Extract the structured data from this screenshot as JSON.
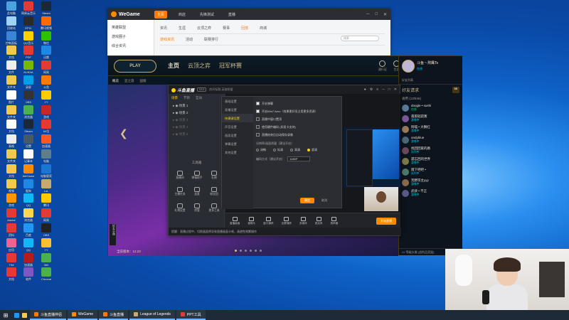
{
  "desktop": {
    "icons": [
      {
        "label": "此电脑",
        "color": "#4aa3df"
      },
      {
        "label": "网易云音乐",
        "color": "#e53935"
      },
      {
        "label": "Steam",
        "color": "#1b2838"
      },
      {
        "label": "回收站",
        "color": "#9fd3f5"
      },
      {
        "label": "EPIC",
        "color": "#2a2a2a"
      },
      {
        "label": "腾讯视频",
        "color": "#ff6a00"
      },
      {
        "label": "控制面板",
        "color": "#3a86d6"
      },
      {
        "label": "QQ音乐",
        "color": "#ffd000"
      },
      {
        "label": "微信",
        "color": "#2dc100"
      },
      {
        "label": "文档",
        "color": "#f2c94c"
      },
      {
        "label": "PDF",
        "color": "#e53935"
      },
      {
        "label": "迅雷",
        "color": "#1e88e5"
      },
      {
        "label": "文件",
        "color": "#eeeeee"
      },
      {
        "label": "NVIDIA",
        "color": "#76b900"
      },
      {
        "label": "网易",
        "color": "#e53935"
      },
      {
        "label": "文件夹",
        "color": "#f2c94c"
      },
      {
        "label": "录屏",
        "color": "#00a0e9"
      },
      {
        "label": "斗鱼",
        "color": "#ff7a00"
      },
      {
        "label": "图片",
        "color": "#ffffff"
      },
      {
        "label": "OBS",
        "color": "#333333"
      },
      {
        "label": "YY",
        "color": "#ffcc00"
      },
      {
        "label": "文件夹",
        "color": "#f2c94c"
      },
      {
        "label": "浏览器",
        "color": "#4caf50"
      },
      {
        "label": "游戏",
        "color": "#c62828"
      },
      {
        "label": "文档",
        "color": "#ffffff"
      },
      {
        "label": "Steam",
        "color": "#1b2838"
      },
      {
        "label": "64位",
        "color": "#e53935"
      },
      {
        "label": "表格",
        "color": "#eeeeee"
      },
      {
        "label": "设置",
        "color": "#455a64"
      },
      {
        "label": "加速器",
        "color": "#ff5722"
      },
      {
        "label": "文件夹",
        "color": "#f2c94c"
      },
      {
        "label": "记事本",
        "color": "#ffffff"
      },
      {
        "label": "电脑",
        "color": "#607d8b"
      },
      {
        "label": "文档",
        "color": "#f2c94c"
      },
      {
        "label": "WeGame",
        "color": "#ff8a00"
      },
      {
        "label": "电脑管家",
        "color": "#1976d2"
      },
      {
        "label": "视频",
        "color": "#f2c94c"
      },
      {
        "label": "酷狗",
        "color": "#1e88e5"
      },
      {
        "label": "LoL",
        "color": "#c8aa6e"
      },
      {
        "label": "游戏",
        "color": "#ff9800"
      },
      {
        "label": "QQ",
        "color": "#12b7f5"
      },
      {
        "label": "腾讯",
        "color": "#ffcc00"
      },
      {
        "label": "Adobe",
        "color": "#e53935"
      },
      {
        "label": "浏览器",
        "color": "#ffd54f"
      },
      {
        "label": "网易",
        "color": "#e53935"
      },
      {
        "label": "资料",
        "color": "#e53935"
      },
      {
        "label": "百度",
        "color": "#2196f3"
      },
      {
        "label": "OBS",
        "color": "#222222"
      },
      {
        "label": "应用",
        "color": "#f06292"
      },
      {
        "label": "QQ",
        "color": "#12b7f5"
      },
      {
        "label": "YY",
        "color": "#fbc02d"
      },
      {
        "label": "TIM",
        "color": "#e53935"
      },
      {
        "label": "加速器",
        "color": "#b71c1c"
      },
      {
        "label": "360",
        "color": "#4caf50"
      },
      {
        "label": "文档",
        "color": "#e53935"
      },
      {
        "label": "软件",
        "color": "#7e57c2"
      },
      {
        "label": "Chrome",
        "color": "#4caf50"
      }
    ]
  },
  "wegame": {
    "logo": "WeGame",
    "nav": [
      "主页",
      "商店",
      "先锋测试",
      "直播"
    ],
    "side": [
      "英雄联盟",
      "游戏圈子",
      "综合资讯"
    ],
    "sub": [
      "资讯",
      "生涯",
      "云顶之弈",
      "赛事",
      "回放",
      "商城"
    ],
    "search_placeholder": "搜索",
    "tabs": [
      "游戏资讯",
      "活动",
      "联赛排行"
    ]
  },
  "lol": {
    "play": "PLAY",
    "tabs": [
      "主页",
      "云顶之弈",
      "冠军杯赛"
    ],
    "sub": [
      "概览",
      "显之旅",
      "国服"
    ],
    "top_icons": [
      "通行证",
      "生涯",
      "藏品",
      "战利品",
      "商城"
    ],
    "rp": "3744",
    "be": "3500",
    "hero_footer": "当前版本：12.23",
    "side_tag": "好友头像",
    "friends": {
      "name": "斗鱼丶熬鹰Ts",
      "status": "在线",
      "tools": "好友列表",
      "title": "好友请求",
      "badge": "30",
      "group": "通用 (13/846)",
      "list": [
        {
          "name": "doogie • sushi",
          "status": "在线",
          "color": "#5a7a9a"
        },
        {
          "name": "夜雨轻寂寞",
          "status": "游戏中",
          "color": "#7a5a9a"
        },
        {
          "name": "阿喵 • 大狮红",
          "status": "游戏中",
          "color": "#9a7a5a"
        },
        {
          "name": "ondyblue",
          "status": "游戏中",
          "color": "#4a6a7a"
        },
        {
          "name": "找回回家的路",
          "status": "队列中",
          "color": "#6a4a5a"
        },
        {
          "name": "遗忘回的世界",
          "status": "游戏中",
          "color": "#7a7a4a"
        },
        {
          "name": "雨下吧吧 •",
          "status": "队列中",
          "color": "#4a7a6a"
        },
        {
          "name": "荒野宗主yyy",
          "status": "游戏中",
          "color": "#8a6a4a"
        },
        {
          "name": "武侠 • 不正",
          "status": "游戏中",
          "color": "#5a5a8a"
        }
      ],
      "footer": "LV 等级头像 (战利品奖励)"
    }
  },
  "stream": {
    "logo": "斗鱼直播",
    "tag": "V2.0",
    "room": "房间标题-英雄联盟",
    "left_tabs": [
      "场景",
      "节目",
      "互动"
    ],
    "scenes": [
      {
        "label": "场景 1",
        "dim": false
      },
      {
        "label": "场景 2",
        "dim": false
      },
      {
        "label": "场景 3",
        "dim": true
      },
      {
        "label": "场景 4",
        "dim": true
      },
      {
        "label": "场景 5",
        "dim": true
      }
    ],
    "tools_title": "工具箱",
    "tools": [
      "直播间",
      "弹幕助手",
      "礼物",
      "主播任务",
      "连麦",
      "粉丝团",
      "礼物设置",
      "房管",
      "更多工具"
    ],
    "bar": [
      "直播画面",
      "摄像头",
      "窗口捕获",
      "全屏捕获",
      "多媒体",
      "麦克风",
      "扬声器"
    ],
    "live_label": "开始直播",
    "status": "提醒：直播过程中，切换画面将导致直播画面卡顿，请避免频繁操作"
  },
  "settings": {
    "side": [
      "基础设置",
      "直播设置",
      "快捷键设置",
      "声音设置",
      "画面设置",
      "弹幕设置",
      "其他设置"
    ],
    "checks": [
      {
        "label": "开启弹幕",
        "on": true
      },
      {
        "label": "开启Win7 Aero（效果更好但占用更多资源）",
        "on": true
      },
      {
        "label": "直播中窗口置顶",
        "on": false
      },
      {
        "label": "使用硬件编码 (如显卡支持)",
        "on": false
      },
      {
        "label": "直播结束后自动保存录像",
        "on": false
      }
    ],
    "res_label": "分辨率/画面质量（建议开启）",
    "options": [
      {
        "label": "流畅",
        "on": false
      },
      {
        "label": "标清",
        "on": false
      },
      {
        "label": "高清",
        "on": false
      },
      {
        "label": "超清",
        "on": true
      }
    ],
    "encode_label": "编码方式（建议开启）",
    "encode_value": "1080P",
    "ok": "确定",
    "cancel": "取消"
  },
  "taskbar": {
    "items": [
      {
        "label": "斗鱼直播伴侣",
        "color": "#ff7a00"
      },
      {
        "label": "WeGame",
        "color": "#ff8a00"
      },
      {
        "label": "斗鱼直播",
        "color": "#ff7a00"
      },
      {
        "label": "League of Legends",
        "color": "#c8aa6e"
      },
      {
        "label": "PPT工具",
        "color": "#e53935"
      }
    ]
  }
}
